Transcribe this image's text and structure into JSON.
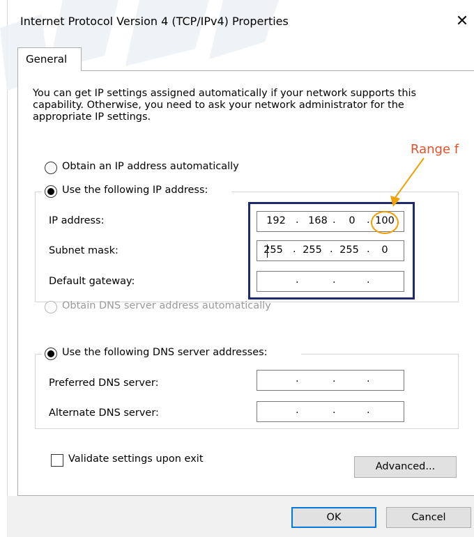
{
  "window": {
    "title": "Internet Protocol Version 4 (TCP/IPv4) Properties",
    "close_glyph": "✕"
  },
  "tabs": [
    {
      "label": "General"
    }
  ],
  "description": "You can get IP settings assigned automatically if your network supports this capability. Otherwise, you need to ask your network administrator for the appropriate IP settings.",
  "ip_section": {
    "auto_option": {
      "label": "Obtain an IP address automatically",
      "selected": false
    },
    "manual_option": {
      "label": "Use the following IP address:",
      "selected": true
    },
    "fields": [
      {
        "label": "IP address:",
        "octets": [
          "192",
          "168",
          "0",
          "100"
        ]
      },
      {
        "label": "Subnet mask:",
        "octets": [
          "255",
          "255",
          "255",
          "0"
        ]
      },
      {
        "label": "Default gateway:",
        "octets": [
          "",
          "",
          "",
          ""
        ]
      }
    ]
  },
  "dns_section": {
    "auto_option": {
      "label": "Obtain DNS server address automatically",
      "selected": false,
      "disabled": true
    },
    "manual_option": {
      "label": "Use the following DNS server addresses:",
      "selected": true
    },
    "fields": [
      {
        "label": "Preferred DNS server:",
        "octets": [
          "",
          "",
          "",
          ""
        ]
      },
      {
        "label": "Alternate DNS server:",
        "octets": [
          "",
          "",
          "",
          ""
        ]
      }
    ]
  },
  "validate": {
    "label": "Validate settings upon exit",
    "checked": false
  },
  "buttons": {
    "advanced": "Advanced...",
    "ok": "OK",
    "cancel": "Cancel"
  },
  "annotation": {
    "text": "Range f",
    "color": "#e0522a",
    "highlight_color": "#1f2a6e",
    "circle_color": "#f0a000"
  },
  "icons": {
    "close": "close-icon",
    "radio": "radio-button",
    "checkbox": "checkbox"
  }
}
